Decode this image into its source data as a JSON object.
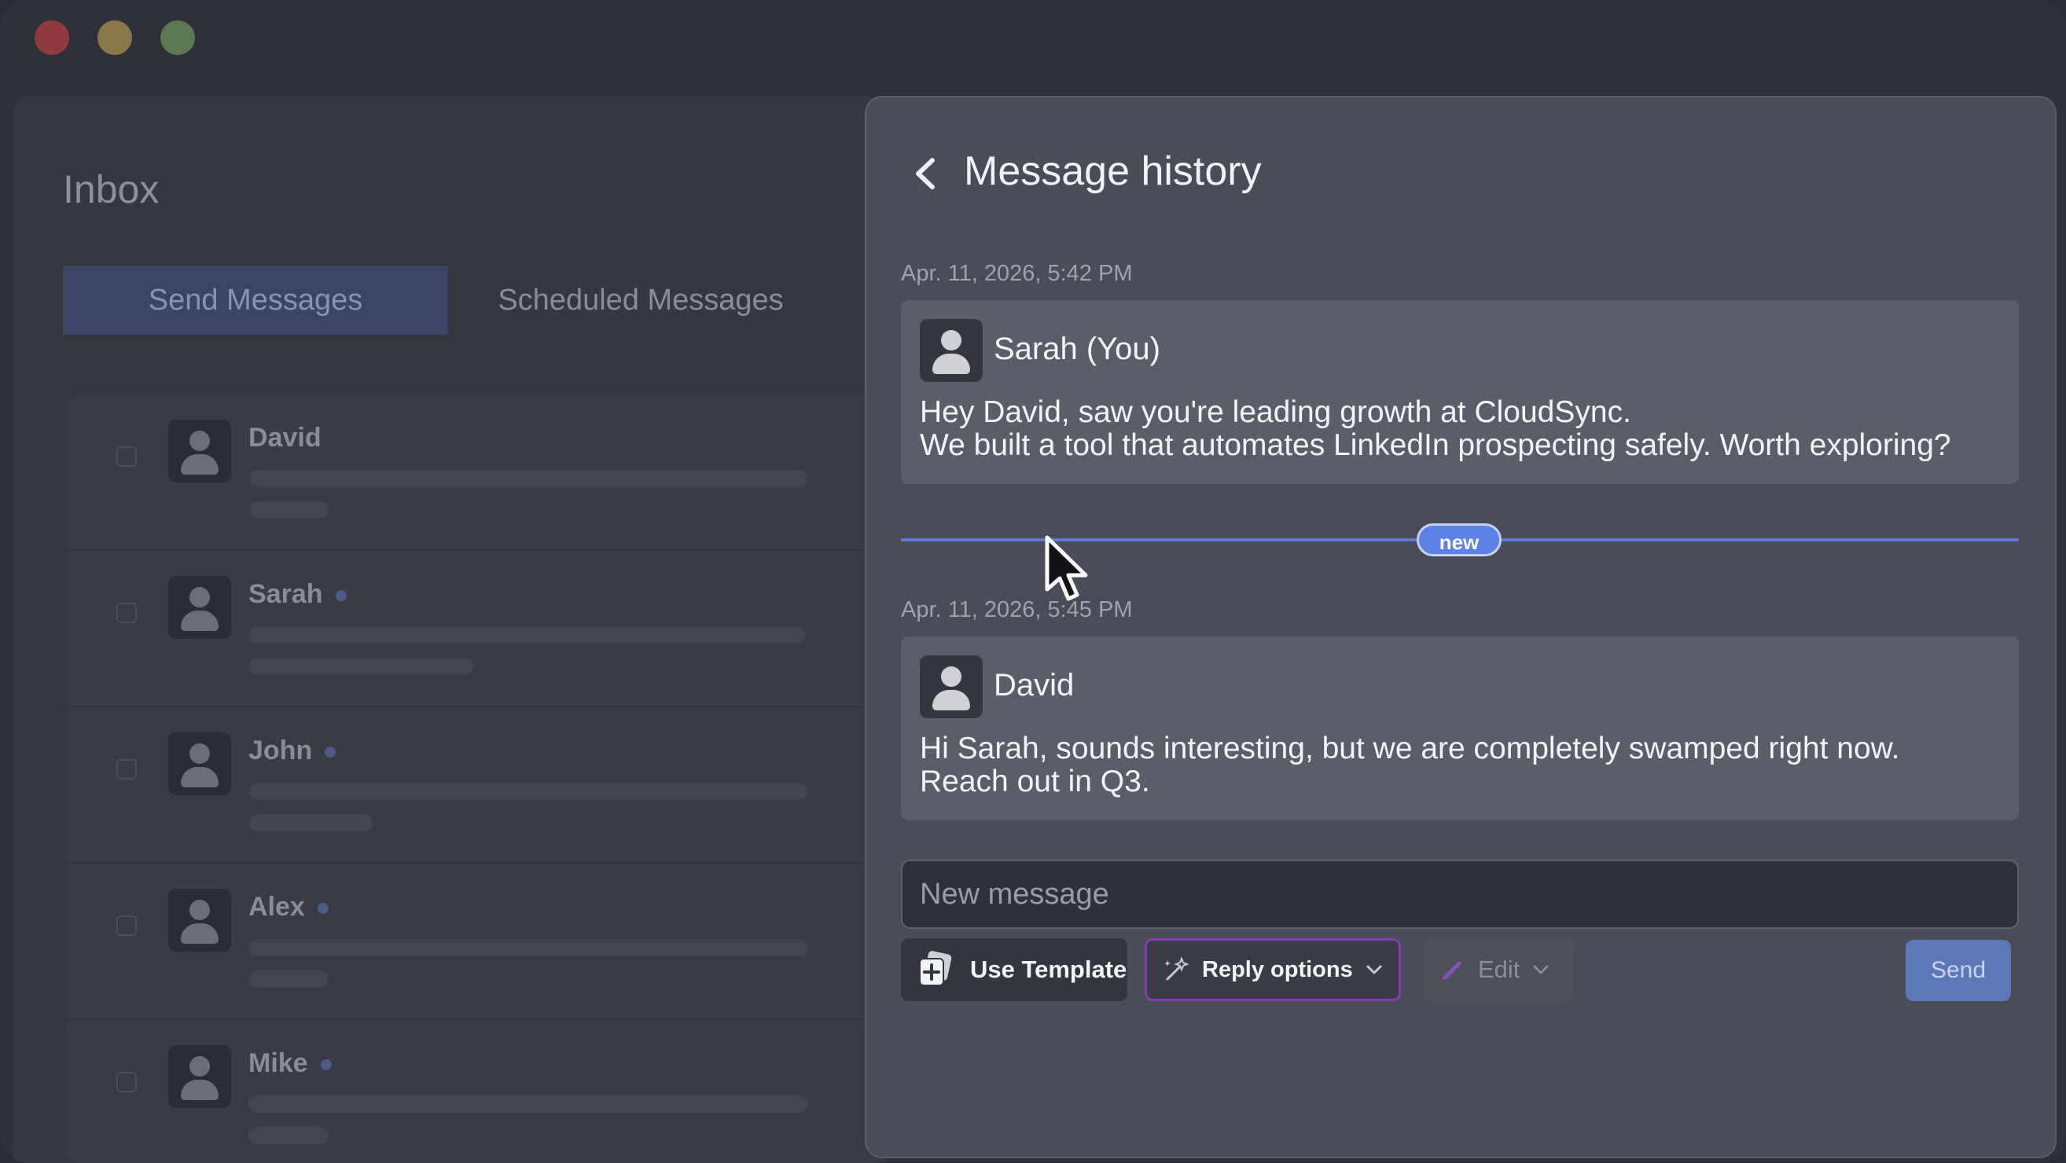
{
  "window": {
    "traffic_lights": [
      "close",
      "minimize",
      "maximize"
    ]
  },
  "inbox": {
    "title": "Inbox",
    "tabs": [
      {
        "label": "Send Messages",
        "active": true
      },
      {
        "label": "Scheduled Messages",
        "active": false
      }
    ],
    "contacts": [
      {
        "name": "David",
        "online": false
      },
      {
        "name": "Sarah",
        "online": true
      },
      {
        "name": "John",
        "online": true
      },
      {
        "name": "Alex",
        "online": true
      },
      {
        "name": "Mike",
        "online": true
      }
    ]
  },
  "history": {
    "title": "Message history",
    "messages": [
      {
        "timestamp": "Apr. 11, 2026, 5:42 PM",
        "sender": "Sarah (You)",
        "text": "Hey David, saw you're leading growth at CloudSync.\nWe built a tool that automates LinkedIn prospecting safely. Worth exploring?"
      },
      {
        "timestamp": "Apr. 11, 2026, 5:45 PM",
        "sender": "David",
        "text": "Hi Sarah, sounds interesting, but we are completely swamped right now.\nReach out in Q3."
      }
    ],
    "divider_label": "new",
    "compose": {
      "placeholder": "New message",
      "value": ""
    },
    "actions": {
      "use_template": "Use Template",
      "reply_options": "Reply options",
      "edit": "Edit",
      "send": "Send"
    }
  },
  "colors": {
    "accent": "#5c82ea",
    "reply_border": "#8a39b8",
    "send_bg": "#5c79b7",
    "panel_bg": "#4a4c57"
  }
}
